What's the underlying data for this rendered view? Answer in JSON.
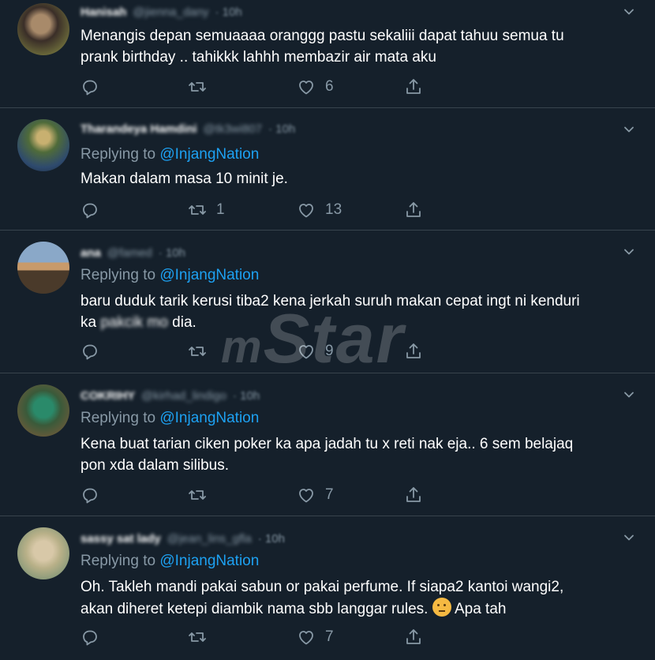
{
  "colors": {
    "background": "#15202b",
    "divider": "#38444d",
    "muted": "#8899a6",
    "accent": "#1da1f2",
    "text": "#ffffff"
  },
  "watermark": {
    "prefix": "m",
    "text": "Star"
  },
  "tweets": [
    {
      "name": "Hanisah",
      "handle": "@jienna_dany",
      "time": "· 10h",
      "reply_prefix": "",
      "mention": "",
      "line1": "Menangis depan semuaaaa oranggg pastu sekaliii dapat tahuu semua tu",
      "line2": "prank birthday .. tahikkk lahhh membazir air mata aku",
      "reply_count": "",
      "retweet_count": "",
      "like_count": "6"
    },
    {
      "name": "Tharandeya Hamdini",
      "handle": "@tk3wi807",
      "time": "· 10h",
      "reply_prefix": "Replying to ",
      "mention": "@InjangNation",
      "line1": "Makan dalam masa 10 minit je.",
      "line2": "",
      "reply_count": "",
      "retweet_count": "1",
      "like_count": "13"
    },
    {
      "name": "ana",
      "handle": "@famed",
      "time": "· 10h",
      "reply_prefix": "Replying to ",
      "mention": "@InjangNation",
      "line1": "baru duduk tarik kerusi tiba2 kena jerkah suruh makan cepat ingt ni kenduri",
      "line2_a": "ka ",
      "line2_blur": "pakcik mo",
      "line2_b": " dia.",
      "reply_count": "",
      "retweet_count": "",
      "like_count": "9"
    },
    {
      "name": "COKRIHY",
      "handle": "@kirhad_lindigo",
      "time": "· 10h",
      "reply_prefix": "Replying to ",
      "mention": "@InjangNation",
      "line1": "Kena buat tarian ciken poker ka apa jadah tu x reti nak eja.. 6 sem belajaq",
      "line2": "pon xda dalam silibus.",
      "reply_count": "",
      "retweet_count": "",
      "like_count": "7"
    },
    {
      "name": "sassy sat lady",
      "handle": "@jean_lins_gfla",
      "time": "· 10h",
      "reply_prefix": "Replying to ",
      "mention": "@InjangNation",
      "line1": "Oh. Takleh mandi pakai sabun or pakai perfume. If siapa2 kantoi wangi2,",
      "line2": "akan diheret ketepi diambik nama sbb langgar rules.",
      "line2_tail": " Apa tah",
      "emoji": "thinking-face-emoji",
      "reply_count": "",
      "retweet_count": "",
      "like_count": "7"
    }
  ]
}
